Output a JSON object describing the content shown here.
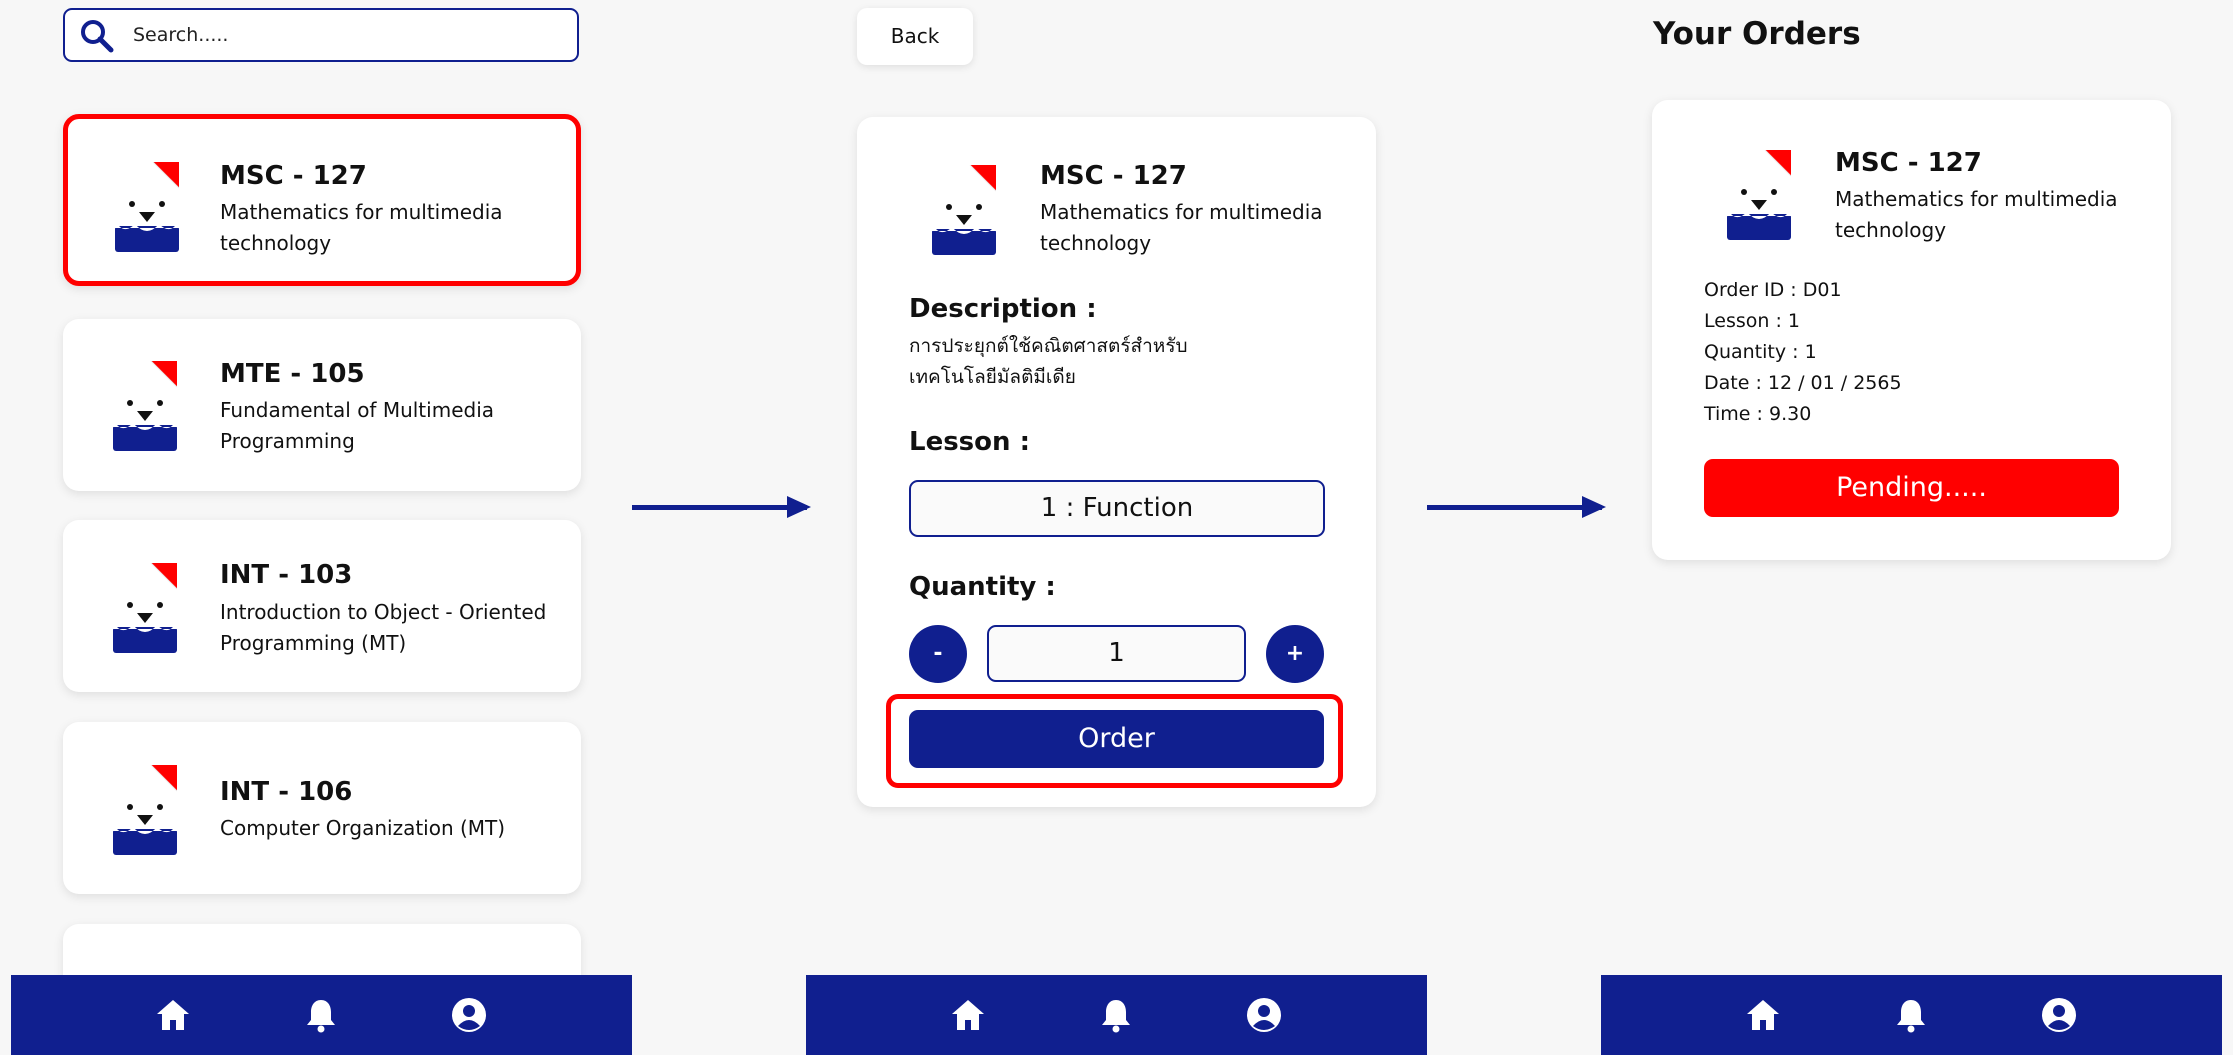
{
  "search": {
    "placeholder": "Search....."
  },
  "courses": [
    {
      "code": "MSC - 127",
      "name_line1": "Mathematics for multimedia",
      "name_line2": "technology"
    },
    {
      "code": "MTE - 105",
      "name_line1": "Fundamental of Multimedia",
      "name_line2": "Programming"
    },
    {
      "code": "INT - 103",
      "name_line1": "Introduction to Object - Oriented",
      "name_line2": "Programming (MT)"
    },
    {
      "code": "INT - 106",
      "name_line1": "Computer Organization (MT)",
      "name_line2": ""
    }
  ],
  "detail": {
    "back_label": "Back",
    "code": "MSC - 127",
    "name_line1": "Mathematics for multimedia",
    "name_line2": "technology",
    "description_label": "Description :",
    "description_line1": "การประยุกต์ใช้คณิตศาสตร์สำหรับ",
    "description_line2": "เทคโนโลยีมัลติมีเดีย",
    "lesson_label": "Lesson :",
    "lesson_value": "1 : Function",
    "quantity_label": "Quantity :",
    "minus_label": "-",
    "plus_label": "+",
    "quantity_value": "1",
    "order_label": "Order"
  },
  "orders": {
    "title": "Your Orders",
    "code": "MSC - 127",
    "name_line1": "Mathematics for multimedia",
    "name_line2": "technology",
    "order_id": "Order ID : D01",
    "lesson": "Lesson : 1",
    "quantity": "Quantity : 1",
    "date": "Date : 12 / 01 / 2565",
    "time": "Time : 9.30",
    "status": "Pending....."
  },
  "nav_icons": [
    "home-icon",
    "bell-icon",
    "profile-icon"
  ],
  "colors": {
    "brand": "#101f8f",
    "accent": "#ff0000",
    "background": "#f7f7f7"
  }
}
